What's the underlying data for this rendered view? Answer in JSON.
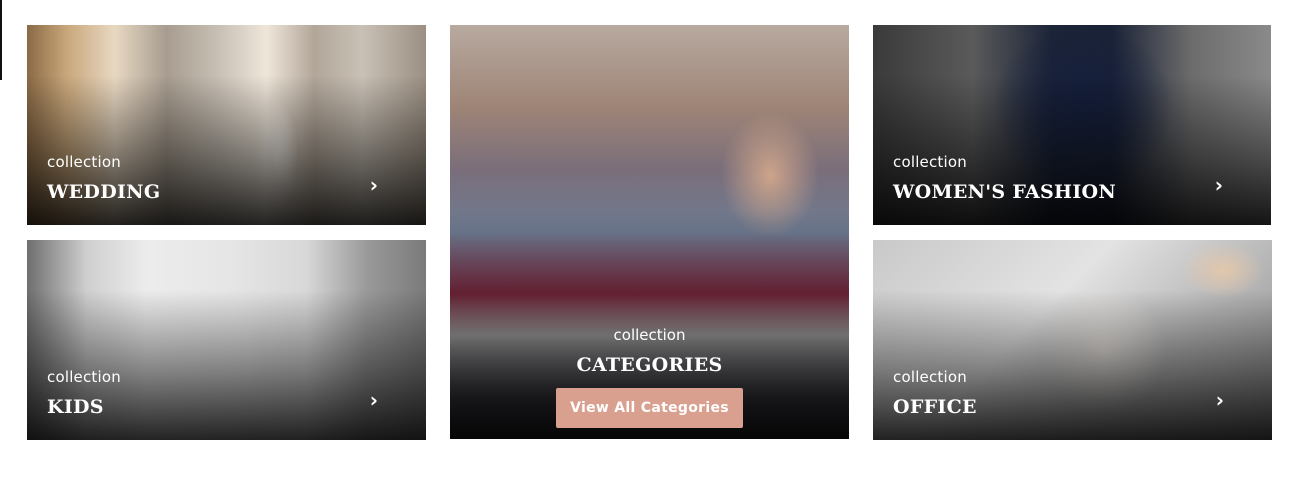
{
  "tiles": {
    "wedding": {
      "kicker": "collection",
      "title": "WEDDING",
      "arrow": "›"
    },
    "kids": {
      "kicker": "collection",
      "title": "KIDS",
      "arrow": "›"
    },
    "categories": {
      "kicker": "collection",
      "title": "CATEGORIES",
      "button": "View All Categories"
    },
    "womens_fashion": {
      "kicker": "collection",
      "title": "WOMEN'S FASHION",
      "arrow": "›"
    },
    "office": {
      "kicker": "collection",
      "title": "OFFICE",
      "arrow": "›"
    }
  },
  "colors": {
    "button_bg": "#d9a08f",
    "text": "#ffffff",
    "page_bg": "#ffffff"
  }
}
